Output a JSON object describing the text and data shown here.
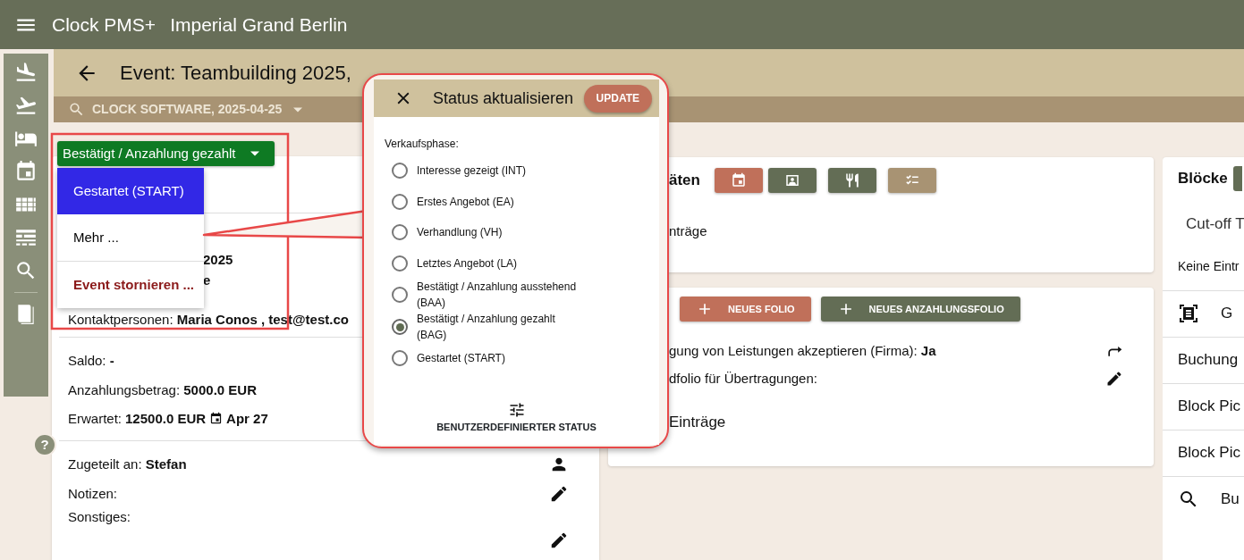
{
  "app_bar": {
    "product": "Clock PMS+",
    "property": "Imperial Grand Berlin"
  },
  "help": {
    "label": "?"
  },
  "page_header": {
    "title": "Event: Teambuilding 2025,"
  },
  "account_bar": {
    "label": "CLOCK SOFTWARE, 2025-04-25"
  },
  "status_button": {
    "label": "Bestätigt / Anzahlung gezahlt"
  },
  "status_menu": {
    "items": [
      {
        "label": "Gestartet (START)",
        "kind": "action",
        "selected": true
      },
      {
        "label": "Mehr ...",
        "kind": "action",
        "selected": false
      },
      {
        "label": "Event stornieren ...",
        "kind": "danger",
        "selected": false
      }
    ]
  },
  "event_card": {
    "partial_lines": [
      "2025",
      "e"
    ],
    "contact": "Kontaktpersonen: **Maria Conos , test@test.co**",
    "finance": [
      "Saldo: **-**",
      "Anzahlungsbetrag: **5000.0 EUR**"
    ],
    "expected": {
      "label": "Erwartet:",
      "amount": "12500.0 EUR",
      "date": "Apr 27"
    },
    "assigned": "Zugeteilt an: **Stefan**",
    "notes_label": "Notizen:",
    "other_label": "Sonstiges:"
  },
  "dialog": {
    "title": "Status aktualisieren",
    "update": "UPDATE",
    "section_label": "Verkaufsphase:",
    "options": [
      {
        "label": "Interesse gezeigt (INT)",
        "selected": false
      },
      {
        "label": "Erstes Angebot (EA)",
        "selected": false
      },
      {
        "label": "Verhandlung (VH)",
        "selected": false
      },
      {
        "label": "Letztes Angebot (LA)",
        "selected": false
      },
      {
        "label": "Bestätigt / Anzahlung ausstehend (BAA)",
        "selected": false
      },
      {
        "label": "Bestätigt / Anzahlung gezahlt (BAG)",
        "selected": true
      },
      {
        "label": "Gestartet (START)",
        "selected": false
      }
    ],
    "custom_status": "BENUTZERDEFINIERTER STATUS"
  },
  "activities_card": {
    "title": "äten",
    "empty": "nträge",
    "buttons": [
      {
        "kind": "calendar",
        "color": "#c0705a"
      },
      {
        "kind": "contact",
        "color": "#636d55"
      },
      {
        "kind": "dining",
        "color": "#636d55"
      },
      {
        "kind": "checklist",
        "color": "#a89373"
      }
    ]
  },
  "folio_card": {
    "buttons": [
      {
        "label": "NEUES FOLIO",
        "color": "#c0705a"
      },
      {
        "label": "NEUES ANZAHLUNGSFOLIO",
        "color": "#636d55"
      }
    ],
    "lines": [
      {
        "text": "gung von Leistungen akzeptieren (Firma): **Ja**",
        "kind": "forward"
      },
      {
        "text": "dfolio für Übertragungen:",
        "kind": "edit"
      }
    ],
    "empty": "Einträge"
  },
  "blocks_panel": {
    "title": "Blöcke",
    "cutoff": "Cut-off T",
    "empty": "Keine Eintr",
    "rows": [
      {
        "label": "G",
        "kind": "scan"
      },
      {
        "label": "Buchung",
        "kind": "plain"
      },
      {
        "label": "Block Pic",
        "kind": "plain"
      },
      {
        "label": "Block Pic",
        "kind": "plain"
      },
      {
        "label": "Bu",
        "kind": "search"
      }
    ]
  }
}
